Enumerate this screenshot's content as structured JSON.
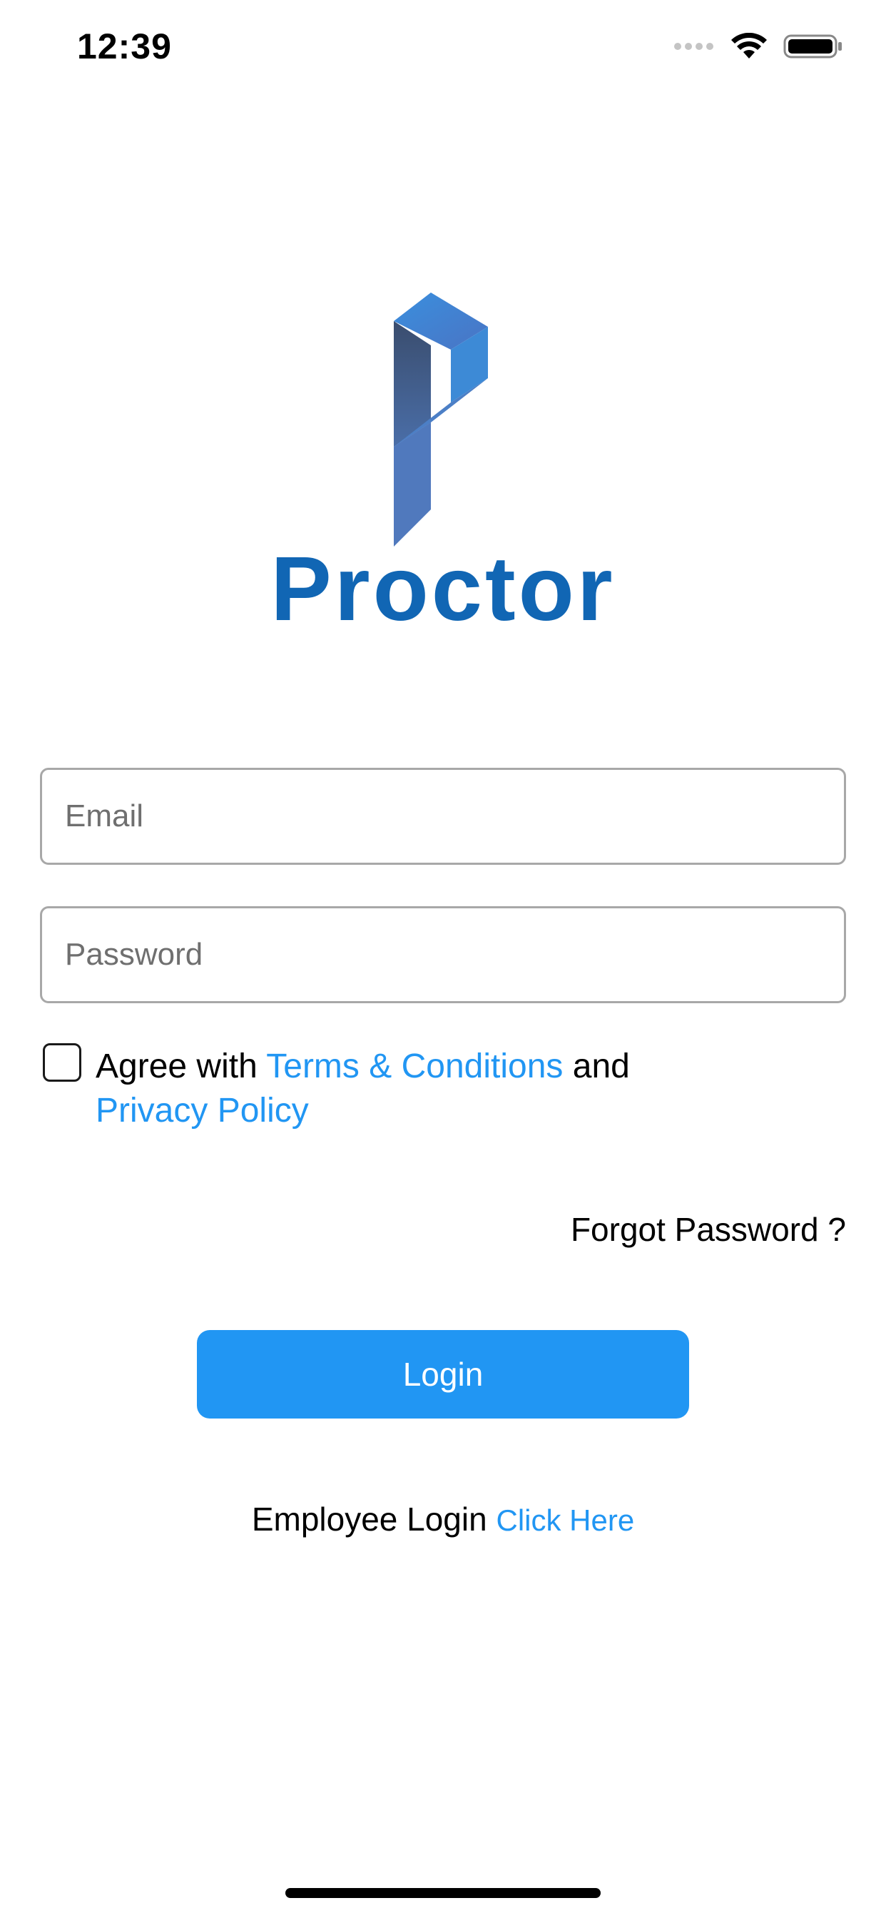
{
  "status_bar": {
    "time": "12:39",
    "icons": [
      "cellular-signal-icon",
      "wifi-icon",
      "battery-icon"
    ]
  },
  "brand": {
    "name": "Proctor",
    "logo_icon": "proctor-p-logo",
    "color": "#1166b4",
    "logo_colors": [
      "#3a8ee0",
      "#4a6fb5",
      "#3b4a66"
    ]
  },
  "form": {
    "email_placeholder": "Email",
    "password_placeholder": "Password",
    "agree_prefix": "Agree with",
    "terms_link": "Terms & Conditions",
    "agree_and": "and",
    "privacy_link": "Privacy Policy",
    "agree_checked": false,
    "forgot_password": "Forgot Password ?",
    "login_button": "Login"
  },
  "footer": {
    "employee_label": "Employee Login",
    "employee_link": "Click Here"
  },
  "colors": {
    "accent": "#2196f3",
    "text": "#000000",
    "field_border": "#a8a8a8"
  }
}
